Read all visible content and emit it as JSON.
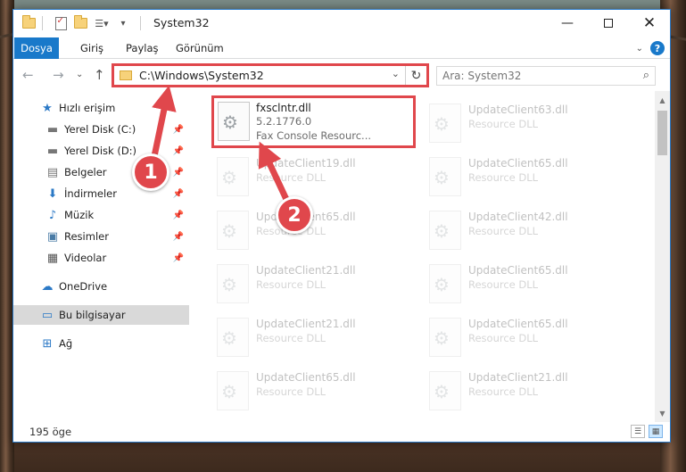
{
  "window": {
    "title": "System32",
    "minimize_icon": "minimize-icon",
    "maximize_icon": "maximize-icon",
    "close_icon": "close-icon"
  },
  "ribbon": {
    "tabs": [
      {
        "label": "Dosya"
      },
      {
        "label": "Giriş"
      },
      {
        "label": "Paylaş"
      },
      {
        "label": "Görünüm"
      }
    ],
    "help_label": "?"
  },
  "address_bar": {
    "path": "C:\\Windows\\System32",
    "refresh_icon": "refresh-icon"
  },
  "search": {
    "placeholder": "Ara: System32"
  },
  "nav_pane": {
    "items": [
      {
        "label": "Hızlı erişim",
        "icon": "star-icon"
      },
      {
        "label": "Yerel Disk (C:)",
        "icon": "drive-icon",
        "pinned": true
      },
      {
        "label": "Yerel Disk (D:)",
        "icon": "drive-icon",
        "pinned": true
      },
      {
        "label": "Belgeler",
        "icon": "document-icon",
        "pinned": true
      },
      {
        "label": "İndirmeler",
        "icon": "download-icon",
        "pinned": true
      },
      {
        "label": "Müzik",
        "icon": "music-icon",
        "pinned": true
      },
      {
        "label": "Resimler",
        "icon": "pictures-icon",
        "pinned": true
      },
      {
        "label": "Videolar",
        "icon": "video-icon",
        "pinned": true
      },
      {
        "label": "OneDrive",
        "icon": "cloud-icon"
      },
      {
        "label": "Bu bilgisayar",
        "icon": "computer-icon",
        "selected": true
      },
      {
        "label": "Ağ",
        "icon": "network-icon"
      }
    ]
  },
  "files": [
    {
      "name": "fxsclntr.dll",
      "line2": "5.2.1776.0",
      "line3": "Fax Console Resourc...",
      "highlighted": true
    },
    {
      "name": "UpdateClient63.dll",
      "line2": "Resource DLL"
    },
    {
      "name": "UpdateClient19.dll",
      "line2": "Resource DLL"
    },
    {
      "name": "UpdateClient65.dll",
      "line2": "Resource DLL"
    },
    {
      "name": "UpdateClient65.dll",
      "line2": "Resource DLL"
    },
    {
      "name": "UpdateClient42.dll",
      "line2": "Resource DLL"
    },
    {
      "name": "UpdateClient21.dll",
      "line2": "Resource DLL"
    },
    {
      "name": "UpdateClient65.dll",
      "line2": "Resource DLL"
    },
    {
      "name": "UpdateClient21.dll",
      "line2": "Resource DLL"
    },
    {
      "name": "UpdateClient65.dll",
      "line2": "Resource DLL"
    },
    {
      "name": "UpdateClient65.dll",
      "line2": "Resource DLL"
    },
    {
      "name": "UpdateClient21.dll",
      "line2": "Resource DLL"
    }
  ],
  "status_bar": {
    "item_count": "195 öge"
  },
  "annotations": {
    "badge_1": "1",
    "badge_2": "2",
    "color": "#e0474c"
  }
}
